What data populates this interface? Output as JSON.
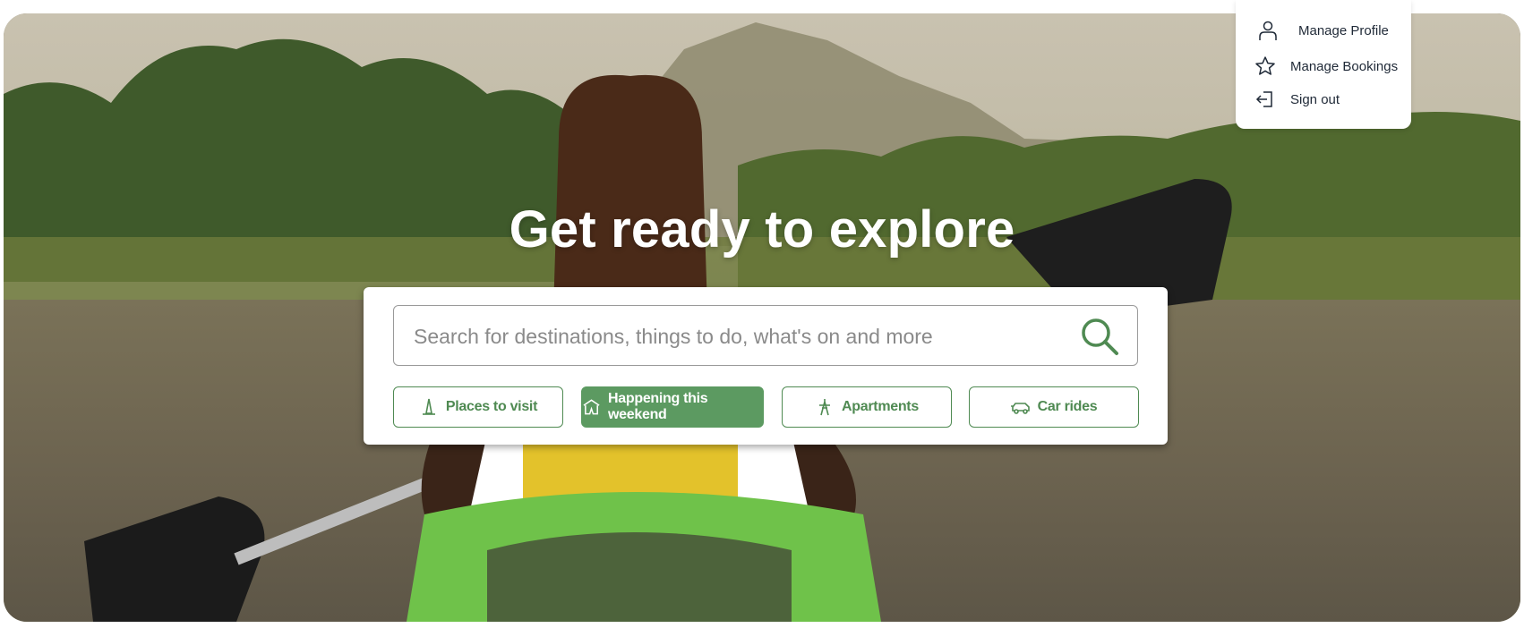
{
  "hero": {
    "headline": "Get ready to explore",
    "background_image": "person-kayaking-on-lake"
  },
  "search": {
    "placeholder": "Search for destinations, things to do, what's on and more",
    "icon": "search-icon"
  },
  "categories": [
    {
      "label": "Places to visit",
      "icon": "landmark-icon",
      "active": false
    },
    {
      "label": "Happening this weekend",
      "icon": "event-tent-icon",
      "active": true
    },
    {
      "label": "Apartments",
      "icon": "tower-icon",
      "active": false
    },
    {
      "label": "Car rides",
      "icon": "car-icon",
      "active": false
    }
  ],
  "user_menu": {
    "items": [
      {
        "label": "Manage Profile",
        "icon": "user-icon"
      },
      {
        "label": "Manage Bookings",
        "icon": "star-icon"
      },
      {
        "label": "Sign out",
        "icon": "sign-out-icon"
      }
    ]
  },
  "colors": {
    "accent": "#5c9a61",
    "accent_border": "#4f8a52",
    "headline": "#ffffff"
  }
}
